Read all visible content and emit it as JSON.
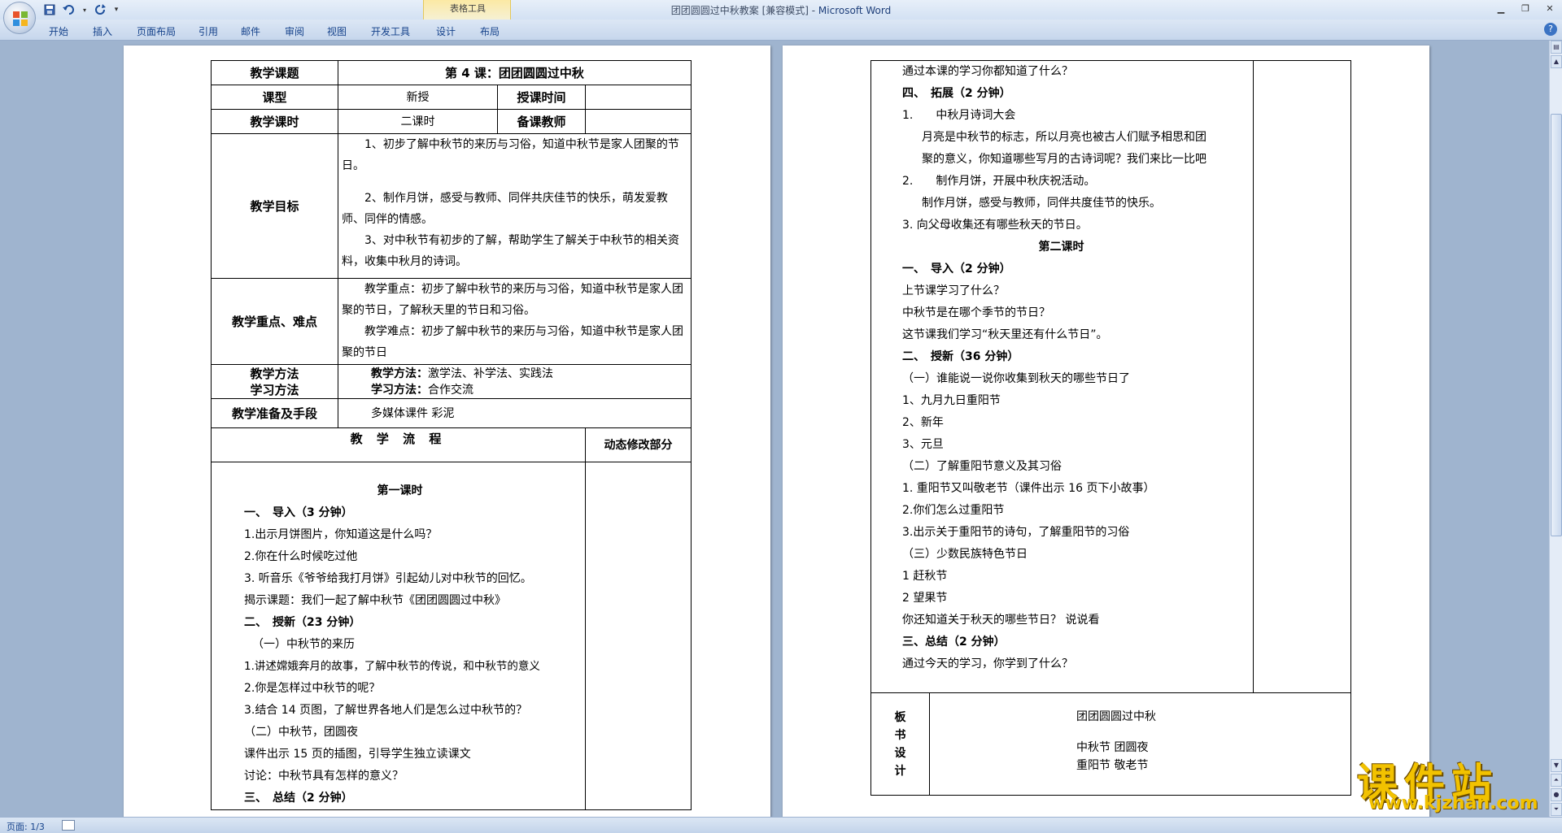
{
  "window": {
    "title": "团团圆圆过中秋教案 [兼容模式] - ",
    "app_name": "Microsoft Word",
    "table_tools_label": "表格工具"
  },
  "ribbon_tabs": [
    "开始",
    "插入",
    "页面布局",
    "引用",
    "邮件",
    "审阅",
    "视图",
    "开发工具",
    "设计",
    "布局"
  ],
  "left_page": {
    "row_title": {
      "label": "教学课题",
      "value": "第 4 课：团团圆圆过中秋"
    },
    "row_type": {
      "label": "课型",
      "value": "新授",
      "label2": "授课时间",
      "value2": ""
    },
    "row_hours": {
      "label": "教学课时",
      "value": "二课时",
      "label2": "备课教师",
      "value2": ""
    },
    "objectives": {
      "label": "教学目标",
      "items": [
        "1、初步了解中秋节的来历与习俗，知道中秋节是家人团聚的节日。",
        "2、制作月饼，感受与教师、同伴共庆佳节的快乐，萌发爱教师、同伴的情感。",
        "3、对中秋节有初步的了解，帮助学生了解关于中秋节的相关资料，收集中秋月的诗词。"
      ]
    },
    "key_points": {
      "label": "教学重点、难点",
      "focus": "教学重点：初步了解中秋节的来历与习俗，知道中秋节是家人团聚的节日，了解秋天里的节日和习俗。",
      "difficulty": "教学难点：初步了解中秋节的来历与习俗，知道中秋节是家人团聚的节日"
    },
    "methods": {
      "label1": "教学方法",
      "label2": "学习方法",
      "teach_label": "教学方法：",
      "teach_value": "激学法、补学法、实践法",
      "learn_label": "学习方法：",
      "learn_value": "合作交流"
    },
    "preparation": {
      "label": "教学准备及手段",
      "value": "多媒体课件 彩泥"
    },
    "flow_header": "教 学 流 程",
    "dynamic_header": "动态修改部分",
    "flow_lines": [
      "第一课时",
      "一、　导入（3 分钟）",
      "1.出示月饼图片，你知道这是什么吗？",
      "2.你在什么时候吃过他",
      "3. 听音乐《爷爷给我打月饼》引起幼儿对中秋节的回忆。",
      "揭示课题：我们一起了解中秋节《团团圆圆过中秋》",
      "二、　授新（23 分钟）",
      "（一）中秋节的来历",
      "1.讲述嫦娥奔月的故事，了解中秋节的传说，和中秋节的意义",
      "2.你是怎样过中秋节的呢？",
      "3.结合 14 页图，了解世界各地人们是怎么过中秋节的？",
      "（二）中秋节，团圆夜",
      "课件出示 15 页的插图，引导学生独立读课文",
      "讨论：中秋节具有怎样的意义？",
      "三、　总结（2 分钟）"
    ]
  },
  "right_page": {
    "lines": [
      "通过本课的学习你都知道了什么？",
      "四、　拓展（2 分钟）",
      "1.　　中秋月诗词大会",
      "月亮是中秋节的标志，所以月亮也被古人们赋予相思和团",
      "聚的意义，你知道哪些写月的古诗词呢？我们来比一比吧",
      "2.　　制作月饼，开展中秋庆祝活动。",
      "制作月饼，感受与教师，同伴共度佳节的快乐。",
      "3. 向父母收集还有哪些秋天的节日。",
      "第二课时",
      "一、　导入（2 分钟）",
      "上节课学习了什么？",
      "中秋节是在哪个季节的节日？",
      "这节课我们学习“秋天里还有什么节日”。",
      "二、　授新（36 分钟）",
      "（一）谁能说一说你收集到秋天的哪些节日了",
      "1、九月九日重阳节",
      "2、新年",
      "3、元旦",
      "（二）了解重阳节意义及其习俗",
      "1. 重阳节又叫敬老节（课件出示 16 页下小故事）",
      "2.你们怎么过重阳节",
      "3.出示关于重阳节的诗句，了解重阳节的习俗",
      "（三）少数民族特色节日",
      "1 赶秋节",
      "2 望果节",
      "你还知道关于秋天的哪些节日？ 说说看",
      "三、总结（2 分钟）",
      "通过今天的学习，你学到了什么？"
    ],
    "board_label": [
      "板",
      "书",
      "设",
      "计"
    ],
    "board_title": "团团圆圆过中秋",
    "board_line1": "中秋节 团圆夜",
    "board_line2": "重阳节 敬老节"
  },
  "status": {
    "page": "页面: 1/3"
  },
  "watermark": {
    "title": "课件站",
    "url": "www.kjzhan.com"
  }
}
